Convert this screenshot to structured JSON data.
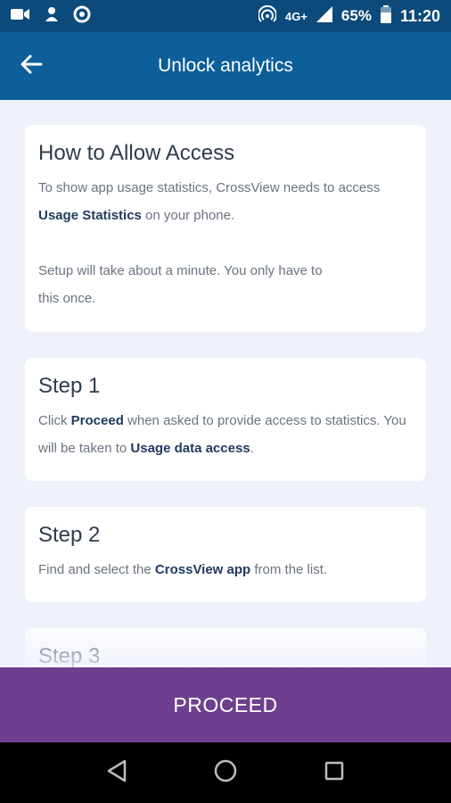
{
  "status_bar": {
    "icons": [
      "video-camera-icon",
      "notification-icon",
      "circle-app-icon"
    ],
    "network": "4G+",
    "battery": "65%",
    "time": "11:20"
  },
  "app_bar": {
    "title": "Unlock analytics",
    "back_icon": "arrow-left-icon"
  },
  "cards": [
    {
      "title": "How to Allow Access",
      "p1_before": "To show app usage statistics, CrossView needs to access ",
      "p1_bold": "Usage Statistics",
      "p1_after": " on your phone.",
      "p2": "Setup will take about a minute. You only have to this once."
    },
    {
      "title": "Step 1",
      "before": "Click ",
      "bold1": "Proceed",
      "middle": " when asked to provide access to statistics. You will be taken to ",
      "bold2": "Usage data access",
      "after": "."
    },
    {
      "title": "Step 2",
      "before": "Find and select the ",
      "bold1": "CrossView app",
      "after": " from the list."
    },
    {
      "title": "Step 3"
    }
  ],
  "proceed_label": "PROCEED",
  "nav_bar": {
    "icons": [
      "back-triangle-icon",
      "home-circle-icon",
      "recents-square-icon"
    ]
  }
}
